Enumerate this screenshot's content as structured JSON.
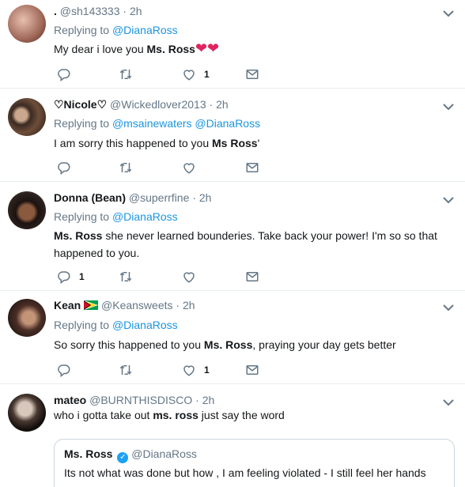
{
  "tweets": [
    {
      "name": ".",
      "handle": "@sh143333",
      "time": "2h",
      "replying_prefix": "Replying to",
      "replying_to": "@DianaRoss",
      "text_pre": "My dear i love you ",
      "text_bold": "Ms. Ross",
      "text_post": "",
      "emoji": "❤❤",
      "reply_count": "",
      "like_count": "1"
    },
    {
      "name": "♡Nicole♡",
      "handle": "@Wickedlover2013",
      "time": "2h",
      "replying_prefix": "Replying to",
      "replying_to": "@msainewaters @DianaRoss",
      "text_pre": "I am sorry this happened to you ",
      "text_bold": "Ms Ross",
      "text_post": "'",
      "reply_count": "",
      "like_count": ""
    },
    {
      "name": "Donna (Bean)",
      "handle": "@superrfine",
      "time": "2h",
      "replying_prefix": "Replying to",
      "replying_to": "@DianaRoss",
      "text_bold": "Ms. Ross",
      "text_line1": " she never learned bounderies. Take back your power! I'm so so that",
      "text_line2": "happened to you.",
      "reply_count": "1",
      "like_count": ""
    },
    {
      "name": "Kean",
      "handle": "@Keansweets",
      "time": "2h",
      "replying_prefix": "Replying to",
      "replying_to": "@DianaRoss",
      "text_pre": "So sorry this happened to you ",
      "text_bold": "Ms. Ross",
      "text_post": ", praying your day gets better",
      "reply_count": "",
      "like_count": "1"
    },
    {
      "name": "mateo",
      "handle": "@BURNTHISDISCO",
      "time": "2h",
      "text_pre": "who i gotta take out ",
      "text_bold": "ms. ross",
      "text_post": " just say the word",
      "quote_name": "Ms. Ross",
      "quote_handle": "@DianaRoss",
      "quote_text": "Its not what  was done but how , I am feeling violated - I still feel her hands"
    }
  ],
  "sep": "·",
  "icons": [
    "reply-icon",
    "retweet-icon",
    "like-icon",
    "dm-icon",
    "chevron-down-icon",
    "verified-icon",
    "guyana-flag-icon"
  ]
}
